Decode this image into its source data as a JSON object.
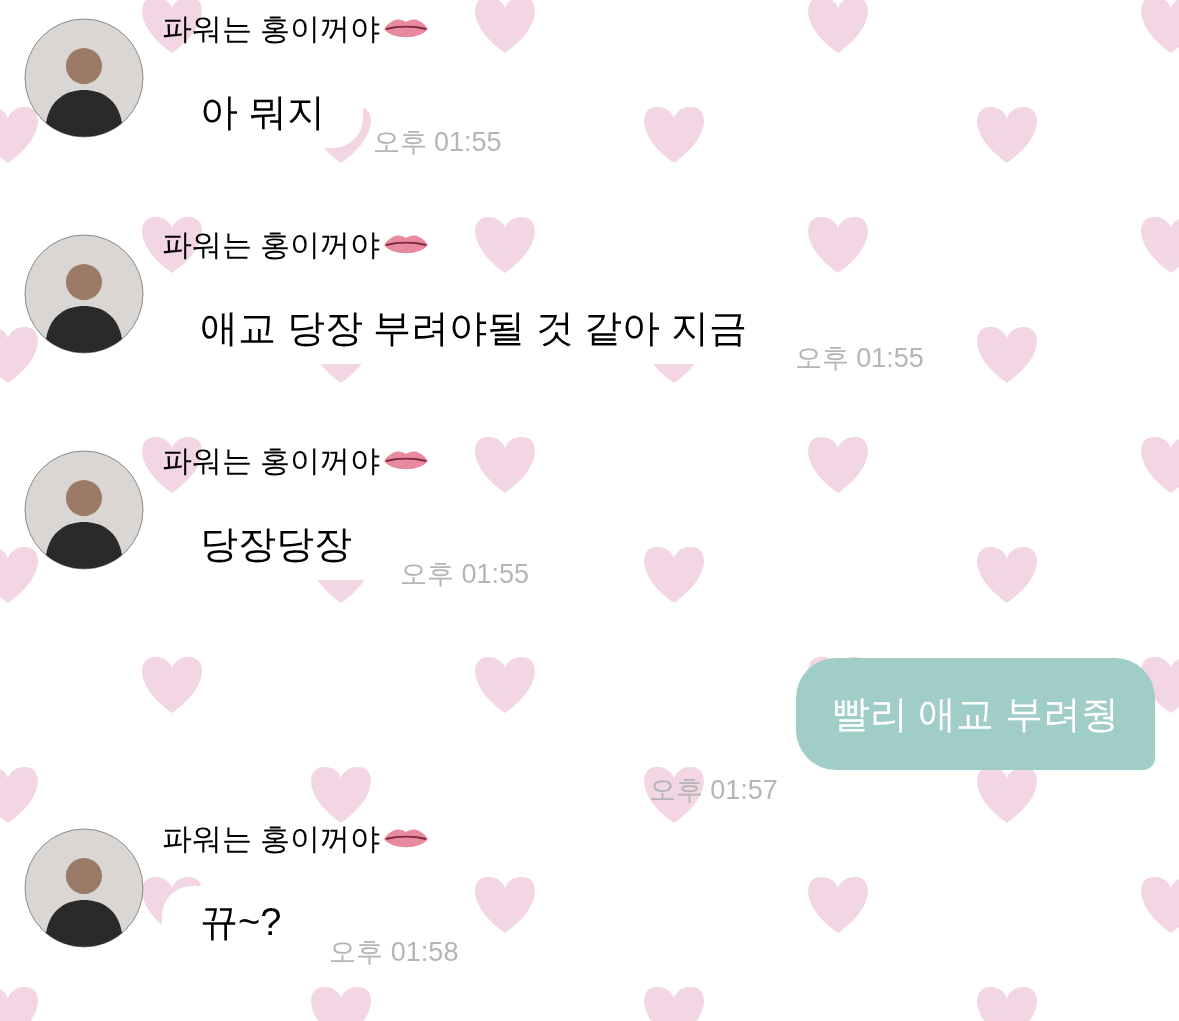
{
  "messages": [
    {
      "kind": "incoming",
      "sender": "파워는 홍이꺼야",
      "text": "아 뭐지",
      "time": "오후 01:55"
    },
    {
      "kind": "incoming",
      "sender": "파워는 홍이꺼야",
      "text": "애교 당장 부려야될 것 같아 지금",
      "time": "오후 01:55"
    },
    {
      "kind": "incoming",
      "sender": "파워는 홍이꺼야",
      "text": "당장당장",
      "time": "오후 01:55"
    },
    {
      "kind": "outgoing",
      "text": "빨리 애교 부려줭",
      "time": "오후 01:57"
    },
    {
      "kind": "incoming",
      "sender": "파워는 홍이꺼야",
      "text": "뀨~?",
      "time": "오후 01:58"
    }
  ]
}
